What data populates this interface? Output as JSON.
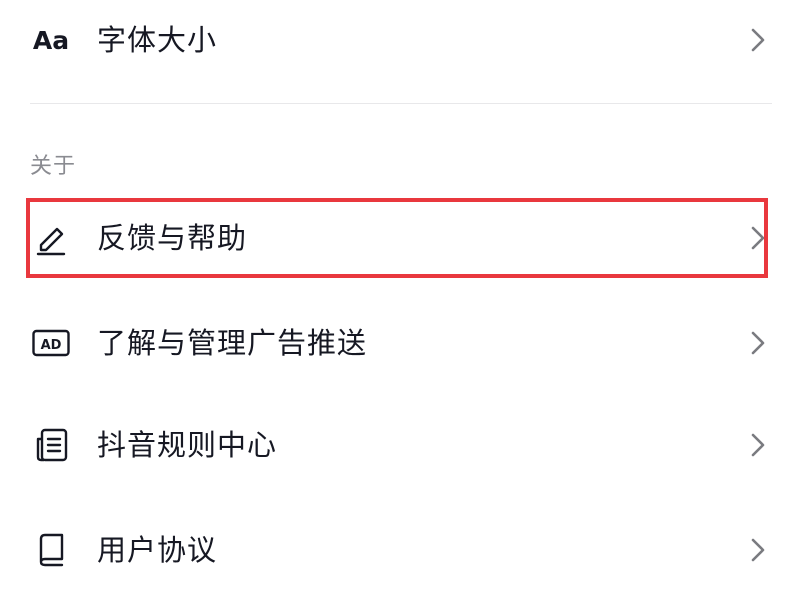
{
  "settings": {
    "font_size": {
      "icon_text": "Aa",
      "label": "字体大小"
    },
    "section_about": "关于",
    "items": [
      {
        "label": "反馈与帮助",
        "icon": "pencil-icon"
      },
      {
        "label": "了解与管理广告推送",
        "icon": "ad-icon"
      },
      {
        "label": "抖音规则中心",
        "icon": "document-list-icon"
      },
      {
        "label": "用户协议",
        "icon": "book-icon"
      }
    ]
  },
  "colors": {
    "highlight": "#e9383e",
    "text": "#161823",
    "section_text": "#8a8b91",
    "chevron": "#7a7b80",
    "divider": "#e8e8ea"
  }
}
